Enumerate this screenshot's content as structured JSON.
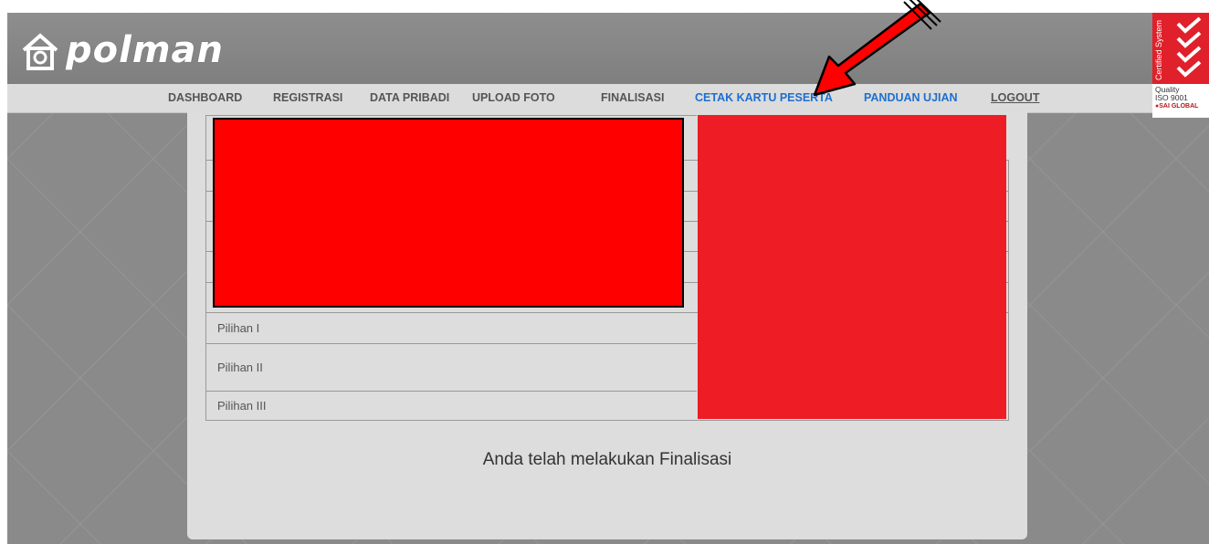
{
  "header": {
    "logo_text": "polman",
    "logo_icon": "home-circle-icon"
  },
  "nav": {
    "items": [
      {
        "label": "DASHBOARD"
      },
      {
        "label": "REGISTRASI"
      },
      {
        "label": "DATA PRIBADI"
      },
      {
        "label": "UPLOAD FOTO"
      },
      {
        "label": "FINALISASI"
      },
      {
        "label": "CETAK KARTU PESERTA"
      },
      {
        "label": "PANDUAN UJIAN"
      },
      {
        "label": "LOGOUT"
      }
    ],
    "active_color": "#1e6fd0"
  },
  "badge": {
    "vertical_text": "Certified System",
    "line1": "Quality",
    "line2": "ISO 9001",
    "line3": "SAI GLOBAL"
  },
  "table": {
    "rows": [
      {
        "label": "Pilihan I"
      },
      {
        "label": "Pilihan II"
      },
      {
        "label": "Pilihan III"
      }
    ]
  },
  "message": "Anda telah melakukan Finalisasi",
  "colors": {
    "redaction": "#ff0000",
    "redaction_photo": "#ee1c25",
    "arrow": "#ff0000"
  }
}
